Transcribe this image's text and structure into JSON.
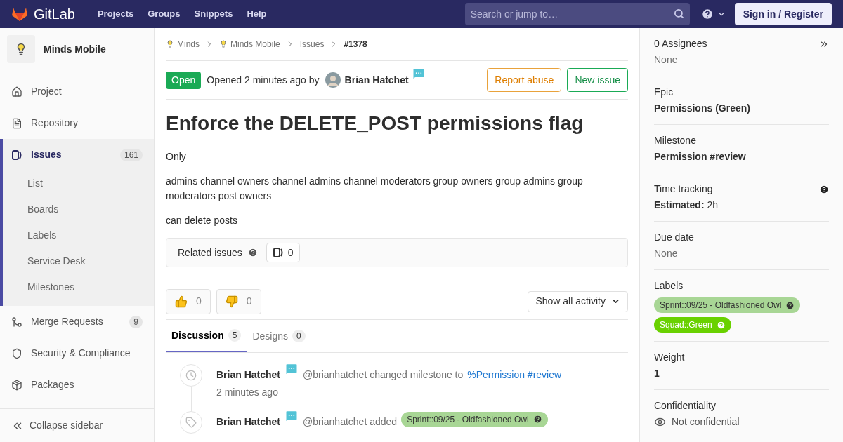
{
  "header": {
    "brand": "GitLab",
    "nav": [
      "Projects",
      "Groups",
      "Snippets",
      "Help"
    ],
    "search": {
      "placeholder": "Search or jump to…"
    },
    "sign_in": "Sign in / Register"
  },
  "sidebar": {
    "project": "Minds Mobile",
    "items": [
      {
        "kind": "home",
        "label": "Project",
        "selected": false
      },
      {
        "kind": "repo",
        "label": "Repository",
        "selected": false
      },
      {
        "kind": "issues",
        "label": "Issues",
        "count": "161",
        "selected": true,
        "children": [
          {
            "label": "List",
            "selected": false
          },
          {
            "label": "Boards",
            "selected": false
          },
          {
            "label": "Labels",
            "selected": false
          },
          {
            "label": "Service Desk",
            "selected": false
          },
          {
            "label": "Milestones",
            "selected": false
          }
        ]
      },
      {
        "kind": "merge",
        "label": "Merge Requests",
        "count": "9",
        "selected": false
      },
      {
        "kind": "shield",
        "label": "Security & Compliance",
        "selected": false
      },
      {
        "kind": "package",
        "label": "Packages",
        "selected": false
      }
    ],
    "collapse": "Collapse sidebar"
  },
  "breadcrumbs": [
    {
      "label": "Minds",
      "avatar": true
    },
    {
      "label": "Minds Mobile",
      "avatar": true
    },
    {
      "label": "Issues",
      "avatar": false
    },
    {
      "label": "#1378",
      "avatar": false
    }
  ],
  "issue": {
    "status": "Open",
    "opened": "Opened 2 minutes ago by",
    "author": "Brian Hatchet",
    "report": "Report abuse",
    "new_issue": "New issue",
    "title": "Enforce the DELETE_POST permissions flag",
    "paragraphs": [
      "Only",
      "admins channel owners channel admins channel moderators group owners group admins group moderators post owners",
      "can delete posts"
    ],
    "related": {
      "label": "Related issues",
      "count": "0"
    },
    "reactions": [
      {
        "kind": "up",
        "count": "0"
      },
      {
        "kind": "down",
        "count": "0"
      }
    ],
    "activity_filter": "Show all activity",
    "tabs": [
      {
        "label": "Discussion",
        "count": "5",
        "selected": true
      },
      {
        "label": "Designs",
        "count": "0",
        "selected": false
      }
    ],
    "events": [
      {
        "kind": "milestone",
        "author": "Brian Hatchet",
        "action": "@brianhatchet changed milestone to",
        "target": {
          "kind": "link",
          "text": "%Permission #review"
        },
        "time": "2 minutes ago"
      },
      {
        "kind": "label",
        "author": "Brian Hatchet",
        "action": "@brianhatchet added",
        "target": {
          "kind": "label",
          "text": "Sprint::09/25 - Oldfashioned Owl",
          "color": "#a8d695"
        }
      }
    ]
  },
  "right_sidebar": {
    "sections": [
      {
        "kind": "assignees",
        "title": "0 Assignees",
        "value": "None"
      },
      {
        "kind": "plain",
        "title": "Epic",
        "value": "Permissions (Green)"
      },
      {
        "kind": "plain",
        "title": "Milestone",
        "value": "Permission #review"
      },
      {
        "kind": "time",
        "title": "Time tracking",
        "value": "**Estimated:** 2h"
      },
      {
        "kind": "empty",
        "title": "Due date",
        "value": "None"
      },
      {
        "kind": "labels",
        "title": "Labels",
        "labels": [
          {
            "text": "Sprint::09/25 - Oldfashioned Owl",
            "color": "#a8d695"
          },
          {
            "text": "Squad::Green",
            "color": "#69d100"
          }
        ]
      },
      {
        "kind": "plain",
        "title": "Weight",
        "value": "1"
      },
      {
        "kind": "confidential",
        "title": "Confidentiality",
        "value": "Not confidential"
      }
    ]
  }
}
